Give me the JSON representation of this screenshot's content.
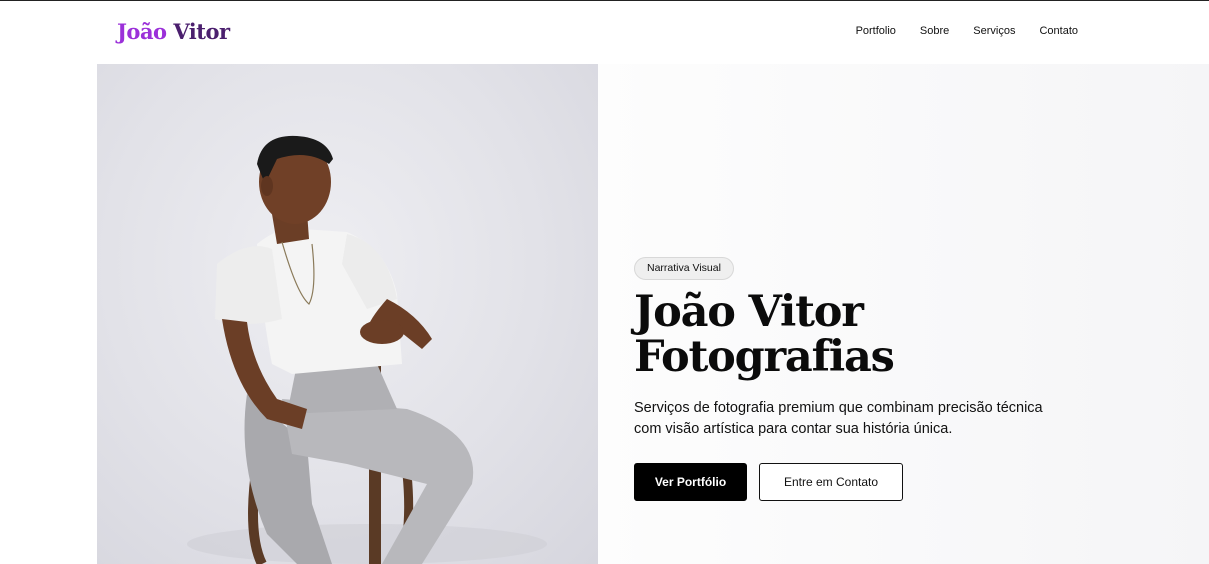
{
  "header": {
    "logo_first": "João",
    "logo_last": "Vitor",
    "nav": [
      {
        "label": "Portfolio"
      },
      {
        "label": "Sobre"
      },
      {
        "label": "Serviços"
      },
      {
        "label": "Contato"
      }
    ]
  },
  "hero": {
    "badge": "Narrativa Visual",
    "title_line1": "João Vitor",
    "title_line2": "Fotografias",
    "description": "Serviços de fotografia premium que combinam precisão técnica com visão artística para contar sua história única.",
    "primary_button": "Ver Portfólio",
    "secondary_button": "Entre em Contato",
    "image_icon": "photo-portrait"
  },
  "colors": {
    "logo_first": "#9b30d9",
    "logo_last": "#4b1f6e",
    "primary_button_bg": "#000000"
  }
}
